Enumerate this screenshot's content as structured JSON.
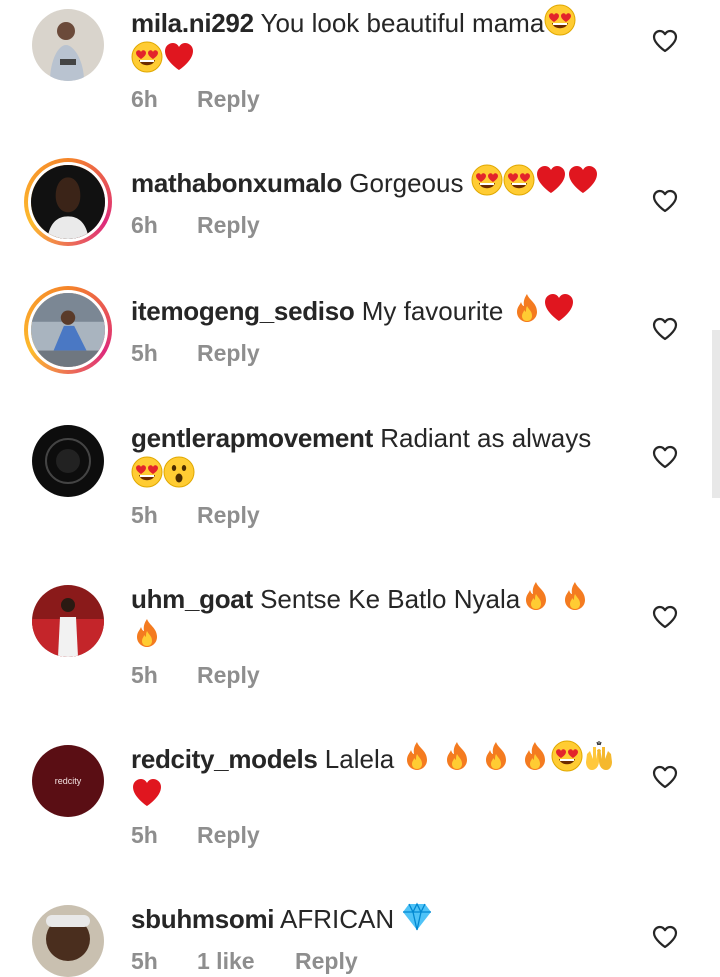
{
  "colors": {
    "text": "#262626",
    "meta": "#8e8e8e",
    "story_ring": "#dd2a7b"
  },
  "comments": [
    {
      "username": "mila.ni292",
      "text": "You look beautiful mama",
      "time": "6h",
      "reply": "Reply",
      "emoji": [
        "heart-eyes",
        "heart-eyes",
        "red-heart"
      ]
    },
    {
      "username": "mathabonxumalo",
      "text": "Gorgeous",
      "time": "6h",
      "reply": "Reply",
      "emoji": [
        "heart-eyes",
        "heart-eyes",
        "red-heart",
        "red-heart"
      ]
    },
    {
      "username": "itemogeng_sediso",
      "text": "My favourite",
      "time": "5h",
      "reply": "Reply",
      "emoji": [
        "fire",
        "red-heart"
      ]
    },
    {
      "username": "gentlerapmovement",
      "text": "Radiant as always",
      "time": "5h",
      "reply": "Reply",
      "emoji": [
        "heart-eyes",
        "astonished"
      ]
    },
    {
      "username": "uhm_goat",
      "text": "Sentse Ke Batlo Nyala",
      "time": "5h",
      "reply": "Reply",
      "emoji": [
        "fire",
        "fire",
        "fire"
      ]
    },
    {
      "username": "redcity_models",
      "text": "Lalela",
      "time": "5h",
      "reply": "Reply",
      "emoji": [
        "fire",
        "fire",
        "fire",
        "fire",
        "heart-eyes",
        "raised-hands",
        "red-heart"
      ],
      "avatar_text": "redcity"
    },
    {
      "username": "sbuhmsomi",
      "text": "AFRICAN",
      "time": "5h",
      "likes": "1 like",
      "reply": "Reply",
      "emoji": [
        "gem"
      ]
    }
  ]
}
